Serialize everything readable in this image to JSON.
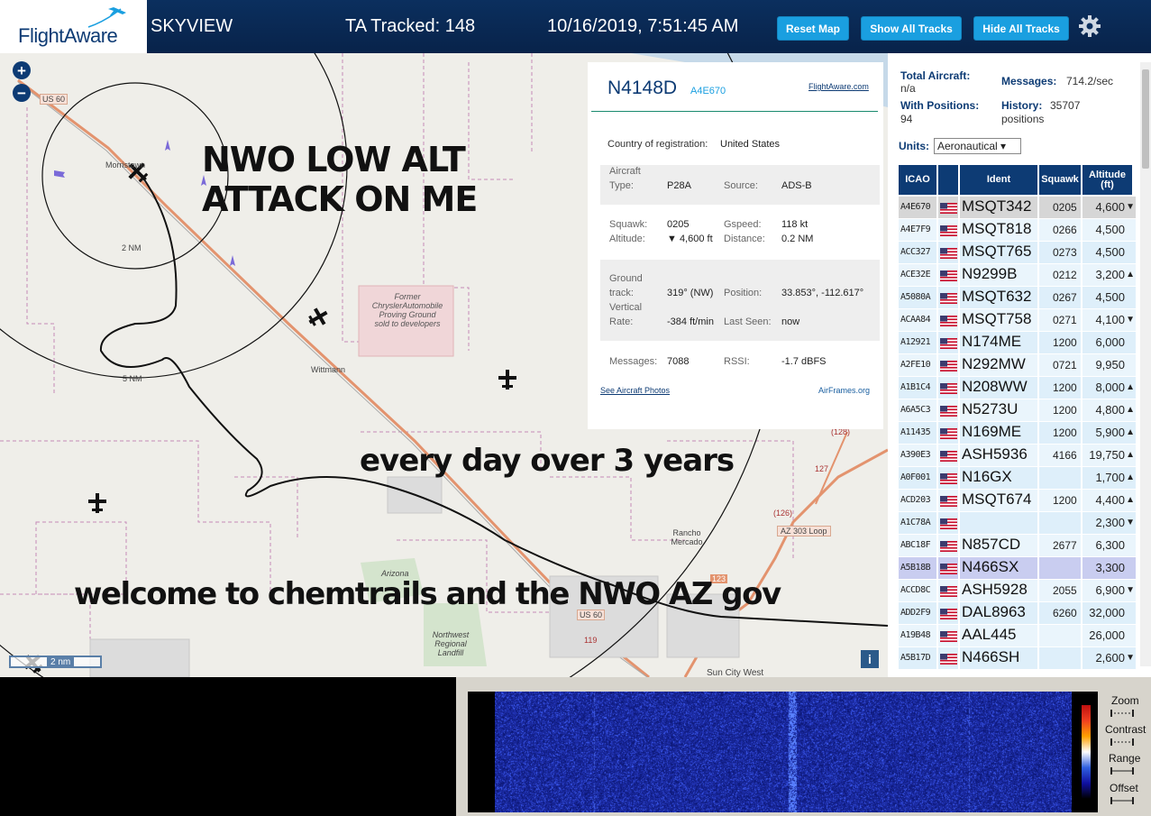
{
  "header": {
    "logo": "FlightAware",
    "title": "SKYVIEW",
    "tracked": "TA Tracked: 148",
    "datetime": "10/16/2019, 7:51:45 AM",
    "buttons": {
      "reset": "Reset Map",
      "show": "Show All Tracks",
      "hide": "Hide All Tracks"
    }
  },
  "map": {
    "annotations": {
      "line1": "NWO LOW ALT",
      "line2": "ATTACK ON ME",
      "line3": "every day over 3 years",
      "line4": "welcome to chemtrails and the NWO AZ gov"
    },
    "labels": {
      "us60_top": "US 60",
      "us60_bottom": "US 60",
      "ring_2nm": "2 NM",
      "ring_5nm": "5 NM",
      "morristown": "Morristown",
      "wittmann": "Wittmann",
      "chrysler": "Former ChryslerAutomobile Proving Ground sold to developers",
      "rancho": "Rancho Mercado",
      "az303": "AZ 303 Loop",
      "landfill": "Northwest Regional Landfill",
      "sun_city": "Sun City West",
      "arizona": "Arizona",
      "rt123": "123",
      "rt126": "(126)",
      "rt127": "127",
      "rt119": "119",
      "rt128": "(128)"
    },
    "scale": "2 nm",
    "zoom_in": "+",
    "zoom_out": "−",
    "info": "i"
  },
  "popup": {
    "registration": "N4148D",
    "hex": "A4E670",
    "fa_link": "FlightAware.com",
    "country_label": "Country of registration:",
    "country": "United States",
    "aircraft_type_label_1": "Aircraft",
    "aircraft_type_label_2": "Type:",
    "aircraft_type": "P28A",
    "source_label": "Source:",
    "source": "ADS-B",
    "squawk_label": "Squawk:",
    "squawk": "0205",
    "gspeed_label": "Gspeed:",
    "gspeed": "118 kt",
    "altitude_label": "Altitude:",
    "altitude": "▼ 4,600 ft",
    "distance_label": "Distance:",
    "distance": "0.2 NM",
    "track_label_1": "Ground",
    "track_label_2": "track:",
    "track": "319° (NW)",
    "position_label": "Position:",
    "position": "33.853°, -112.617°",
    "vrate_label_1": "Vertical",
    "vrate_label_2": "Rate:",
    "vrate": "-384 ft/min",
    "lastseen_label": "Last Seen:",
    "lastseen": "now",
    "messages_label": "Messages:",
    "messages": "7088",
    "rssi_label": "RSSI:",
    "rssi": "-1.7 dBFS",
    "photos_link": "See Aircraft Photos",
    "airframes_link": "AirFrames.org"
  },
  "sidebar": {
    "total_label": "Total Aircraft:",
    "total": "n/a",
    "messages_label": "Messages:",
    "messages": "714.2/sec",
    "positions_label": "With Positions:",
    "positions": "94",
    "history_label": "History:",
    "history": "35707 positions",
    "units_label": "Units:",
    "units": "Aeronautical ▾",
    "columns": [
      "ICAO",
      "Ident",
      "Squawk",
      "Altitude (ft)"
    ],
    "rows": [
      {
        "icao": "A4E670",
        "ident": "MSQT342",
        "squawk": "0205",
        "alt": "4,600",
        "trend": "▼"
      },
      {
        "icao": "A4E7F9",
        "ident": "MSQT818",
        "squawk": "0266",
        "alt": "4,500",
        "trend": ""
      },
      {
        "icao": "ACC327",
        "ident": "MSQT765",
        "squawk": "0273",
        "alt": "4,500",
        "trend": ""
      },
      {
        "icao": "ACE32E",
        "ident": "N9299B",
        "squawk": "0212",
        "alt": "3,200",
        "trend": "▲"
      },
      {
        "icao": "A5080A",
        "ident": "MSQT632",
        "squawk": "0267",
        "alt": "4,500",
        "trend": ""
      },
      {
        "icao": "ACAA84",
        "ident": "MSQT758",
        "squawk": "0271",
        "alt": "4,100",
        "trend": "▼"
      },
      {
        "icao": "A12921",
        "ident": "N174ME",
        "squawk": "1200",
        "alt": "6,000",
        "trend": ""
      },
      {
        "icao": "A2FE10",
        "ident": "N292MW",
        "squawk": "0721",
        "alt": "9,950",
        "trend": ""
      },
      {
        "icao": "A1B1C4",
        "ident": "N208WW",
        "squawk": "1200",
        "alt": "8,000",
        "trend": "▲"
      },
      {
        "icao": "A6A5C3",
        "ident": "N5273U",
        "squawk": "1200",
        "alt": "4,800",
        "trend": "▲"
      },
      {
        "icao": "A11435",
        "ident": "N169ME",
        "squawk": "1200",
        "alt": "5,900",
        "trend": "▲"
      },
      {
        "icao": "A390E3",
        "ident": "ASH5936",
        "squawk": "4166",
        "alt": "19,750",
        "trend": "▲"
      },
      {
        "icao": "A0F001",
        "ident": "N16GX",
        "squawk": "",
        "alt": "1,700",
        "trend": "▲"
      },
      {
        "icao": "ACD203",
        "ident": "MSQT674",
        "squawk": "1200",
        "alt": "4,400",
        "trend": "▲"
      },
      {
        "icao": "A1C78A",
        "ident": "",
        "squawk": "",
        "alt": "2,300",
        "trend": "▼"
      },
      {
        "icao": "ABC18F",
        "ident": "N857CD",
        "squawk": "2677",
        "alt": "6,300",
        "trend": ""
      },
      {
        "icao": "A5B18B",
        "ident": "N466SX",
        "squawk": "",
        "alt": "3,300",
        "trend": ""
      },
      {
        "icao": "ACCD8C",
        "ident": "ASH5928",
        "squawk": "2055",
        "alt": "6,900",
        "trend": "▼"
      },
      {
        "icao": "ADD2F9",
        "ident": "DAL8963",
        "squawk": "6260",
        "alt": "32,000",
        "trend": ""
      },
      {
        "icao": "A19B48",
        "ident": "AAL445",
        "squawk": "",
        "alt": "26,000",
        "trend": ""
      },
      {
        "icao": "A5B17D",
        "ident": "N466SH",
        "squawk": "",
        "alt": "2,600",
        "trend": "▼"
      }
    ]
  },
  "waterfall": {
    "zoom": "Zoom",
    "contrast": "Contrast",
    "range": "Range",
    "offset": "Offset"
  }
}
